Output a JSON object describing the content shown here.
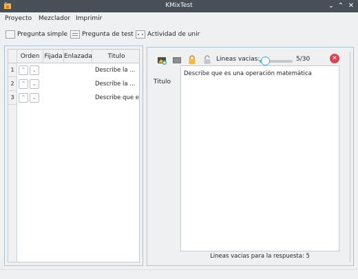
{
  "window": {
    "title": "KMixTest",
    "icons": {
      "app": "kmix-app-icon",
      "minimize": "chevron-down-icon",
      "maximize": "chevron-up-icon",
      "close": "close-icon"
    }
  },
  "menubar": {
    "items": [
      "Proyecto",
      "Mezclador",
      "Imprimir"
    ]
  },
  "toolbar": {
    "items": [
      {
        "label": "Pregunta simple",
        "icon": "blank-page-icon"
      },
      {
        "label": "Pregunta de test",
        "icon": "list-lines-icon"
      },
      {
        "label": "Actividad de unir",
        "icon": "join-dots-icon"
      }
    ]
  },
  "table": {
    "columns": [
      "Orden",
      "Fijada",
      "Enlazada",
      "Titulo"
    ],
    "rows": [
      {
        "num": "1",
        "title": "Describe la ..."
      },
      {
        "num": "2",
        "title": "Describe la ..."
      },
      {
        "num": "3",
        "title": "Describe que e..."
      }
    ],
    "arrow_icons": [
      "arrow-up-icon",
      "arrow-down-icon"
    ]
  },
  "editor": {
    "icons": [
      "add-image-icon",
      "image-icon",
      "lock-closed-icon",
      "lock-open-icon"
    ],
    "lineas_label": "Lineas vacias:",
    "lineas_value": "5/30",
    "lineas_fraction": 0.1667,
    "close_icon": "remove-circle-icon",
    "titulo_label": "Titulo",
    "text": "Describe que es una operación matemática",
    "footer": "Lineas vacias para la respuesta: 5",
    "colors": {
      "accent": "#3daee9",
      "close": "#da4453"
    }
  }
}
